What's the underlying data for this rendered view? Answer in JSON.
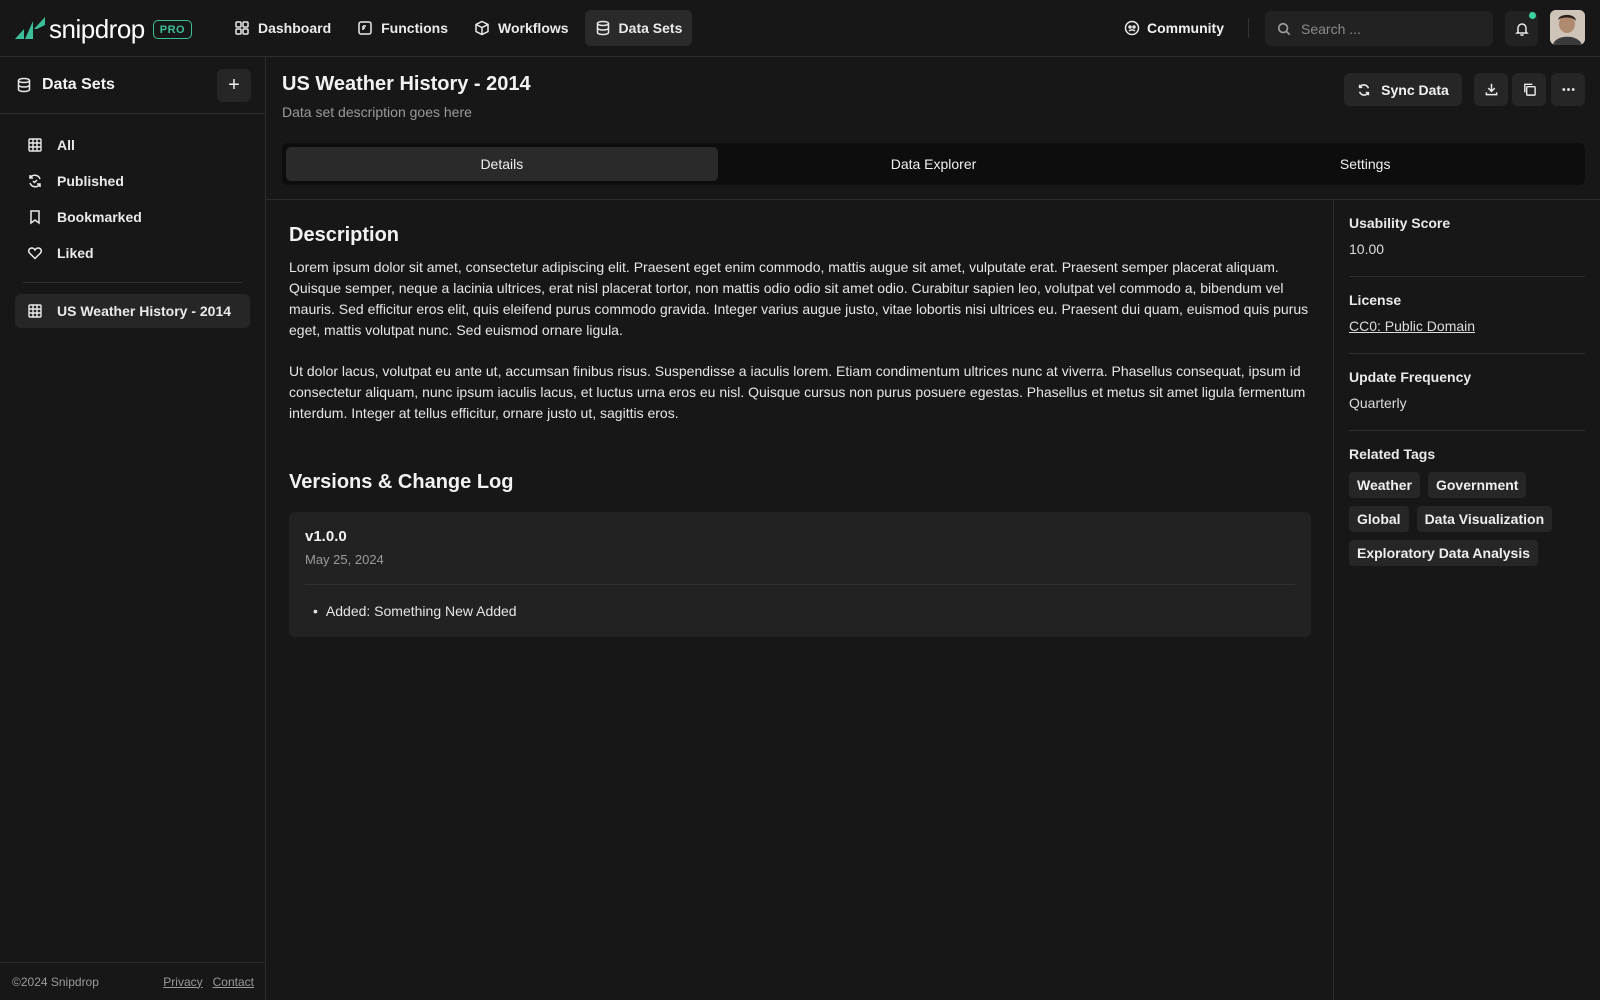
{
  "header": {
    "brand": "snipdrop",
    "badge": "PRO",
    "nav": [
      {
        "label": "Dashboard",
        "icon": "grid-icon"
      },
      {
        "label": "Functions",
        "icon": "function-icon"
      },
      {
        "label": "Workflows",
        "icon": "cube-icon"
      },
      {
        "label": "Data Sets",
        "icon": "database-icon",
        "active": true
      }
    ],
    "community": "Community",
    "search_placeholder": "Search ..."
  },
  "sidebar": {
    "title": "Data Sets",
    "items": [
      {
        "label": "All",
        "icon": "table-icon"
      },
      {
        "label": "Published",
        "icon": "refresh-icon"
      },
      {
        "label": "Bookmarked",
        "icon": "bookmark-icon"
      },
      {
        "label": "Liked",
        "icon": "heart-icon"
      }
    ],
    "datasets": [
      {
        "label": "US Weather History - 2014",
        "icon": "table-icon"
      }
    ],
    "footer": {
      "copyright": "©2024 Snipdrop",
      "privacy": "Privacy",
      "contact": "Contact"
    }
  },
  "page": {
    "title": "US Weather History - 2014",
    "description": "Data set description goes here",
    "sync_label": "Sync Data",
    "tabs": [
      "Details",
      "Data Explorer",
      "Settings"
    ],
    "active_tab": "Details"
  },
  "content": {
    "description_heading": "Description",
    "paragraphs": [
      "Lorem ipsum dolor sit amet, consectetur adipiscing elit. Praesent eget enim commodo, mattis augue sit amet, vulputate erat. Praesent semper placerat aliquam. Quisque semper, neque a lacinia ultrices, erat nisl placerat tortor, non mattis odio odio sit amet odio. Curabitur sapien leo, volutpat vel commodo a, bibendum vel mauris. Sed efficitur eros elit, quis eleifend purus commodo gravida. Integer varius augue justo, vitae lobortis nisi ultrices eu. Praesent dui quam, euismod quis purus eget, mattis volutpat nunc. Sed euismod ornare ligula.",
      "Ut dolor lacus, volutpat eu ante ut, accumsan finibus risus. Suspendisse a iaculis lorem. Etiam condimentum ultrices nunc at viverra. Phasellus consequat, ipsum id consectetur aliquam, nunc ipsum iaculis lacus, et luctus urna eros eu nisl. Quisque cursus non purus posuere egestas. Phasellus et metus sit amet ligula fermentum interdum. Integer at tellus efficitur, ornare justo ut, sagittis eros."
    ],
    "versions_heading": "Versions & Change Log",
    "versions": [
      {
        "version": "v1.0.0",
        "date": "May 25, 2024",
        "changes": [
          "Added: Something New Added"
        ]
      }
    ]
  },
  "panel": {
    "usability_label": "Usability Score",
    "usability_value": "10.00",
    "license_label": "License",
    "license_value": "CC0: Public Domain",
    "frequency_label": "Update Frequency",
    "frequency_value": "Quarterly",
    "tags_label": "Related Tags",
    "tags": [
      "Weather",
      "Government",
      "Global",
      "Data Visualization",
      "Exploratory Data Analysis"
    ]
  },
  "colors": {
    "accent": "#3bbf9a",
    "background": "#171717",
    "surface": "#262626"
  }
}
